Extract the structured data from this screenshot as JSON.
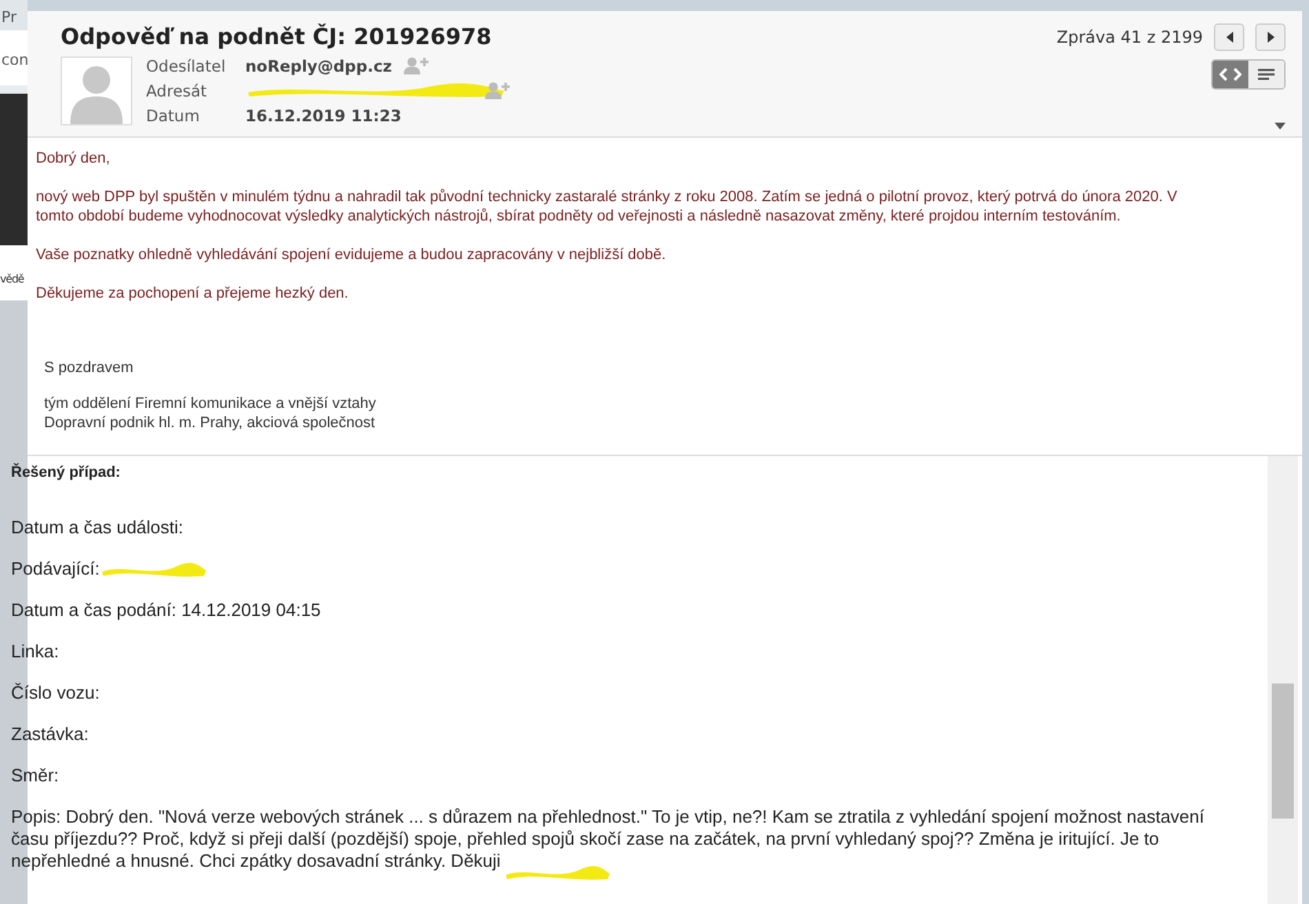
{
  "background_window": {
    "texts": [
      "Pr",
      "con",
      "vědě"
    ]
  },
  "message": {
    "subject": "Odpověď na podnět ČJ: 201926978",
    "counter": "Zpráva 41 z 2199",
    "fields": [
      {
        "label": "Odesílatel",
        "kind": "text",
        "value": "noReply@dpp.cz"
      },
      {
        "label": "Adresát",
        "kind": "redacted"
      },
      {
        "label": "Datum",
        "kind": "text",
        "value": "16.12.2019 11:23"
      }
    ],
    "view_toggle": [
      {
        "kind": "html",
        "selected": true
      },
      {
        "kind": "plain",
        "selected": false
      }
    ]
  },
  "body": {
    "paragraphs": [
      "Dobrý den,",
      "nový web DPP byl spuštěn v minulém týdnu a nahradil tak původní technicky zastaralé stránky z roku 2008. Zatím se jedná o pilotní provoz, který potrvá do února 2020. V tomto období budeme vyhodnocovat výsledky analytických nástrojů, sbírat podněty od veřejnosti a následně nasazovat změny, které projdou interním testováním.",
      "Vaše poznatky ohledně vyhledávání spojení evidujeme a budou zapracovány v nejbližší době.",
      "Děkujeme za pochopení a přejeme hezký den."
    ],
    "signature": {
      "greeting": "S pozdravem",
      "lines": [
        "tým oddělení Firemní komunikace a vnější vztahy",
        "Dopravní podnik hl. m. Prahy, akciová společnost"
      ]
    }
  },
  "case": {
    "title": "Řešený případ:",
    "lines": [
      {
        "text": "Datum a čas události:",
        "redacted": false
      },
      {
        "text": "Podávající:",
        "redacted": true
      },
      {
        "text": "Datum a čas podání: 14.12.2019 04:15",
        "redacted": false
      },
      {
        "text": "Linka:",
        "redacted": false
      },
      {
        "text": "Číslo vozu:",
        "redacted": false
      },
      {
        "text": "Zastávka:",
        "redacted": false
      },
      {
        "text": "Směr:",
        "redacted": false
      },
      {
        "text": "Popis: Dobrý den. \"Nová verze webových stránek ... s důrazem na přehlednost.\" To je vtip, ne?! Kam se ztratila z vyhledání spojení možnost nastavení času příjezdu?? Proč, když si přeji další (pozdější) spoje, přehled spojů skočí zase na začátek, na první vyhledaný spoj?? Změna je iritující. Je to nepřehledné a hnusné. Chci zpátky dosavadní stránky. Děkuji",
        "redacted": true
      }
    ]
  }
}
